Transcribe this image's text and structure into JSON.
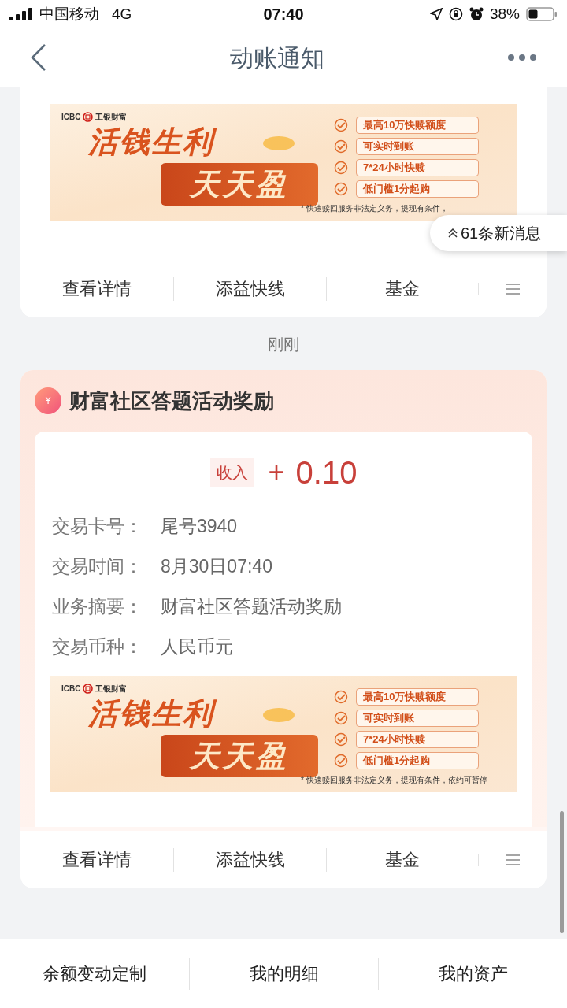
{
  "status_bar": {
    "carrier": "中国移动",
    "network": "4G",
    "time": "07:40",
    "battery": "38%"
  },
  "nav": {
    "title": "动账通知"
  },
  "new_messages": {
    "label": "61条新消息"
  },
  "cards": [
    {
      "kind": "partial",
      "banner": {
        "brand": "ICBC",
        "brand_cn": "工银财富",
        "headline": "活钱生利",
        "highlight": "天天盈",
        "features": [
          "最高10万快赎额度",
          "可实时到账",
          "7*24小时快赎",
          "低门槛1分起购"
        ],
        "footnote": "* 快速赎回服务非法定义务，提现有条件，"
      },
      "actions": [
        "查看详情",
        "添益快线",
        "基金"
      ]
    },
    {
      "kind": "full",
      "time": "刚刚",
      "title": "财富社区答题活动奖励",
      "icon_glyph": "¥",
      "badge": "收入",
      "sign": "+",
      "amount": "0.10",
      "fields": [
        {
          "label": "交易卡号：",
          "value": "尾号3940"
        },
        {
          "label": "交易时间：",
          "value": "8月30日07:40"
        },
        {
          "label": "业务摘要：",
          "value": "财富社区答题活动奖励"
        },
        {
          "label": "交易币种：",
          "value": "人民币元"
        }
      ],
      "banner": {
        "brand": "ICBC",
        "brand_cn": "工银财富",
        "headline": "活钱生利",
        "highlight": "天天盈",
        "features": [
          "最高10万快赎额度",
          "可实时到账",
          "7*24小时快赎",
          "低门槛1分起购"
        ],
        "footnote": "* 快速赎回服务非法定义务，提现有条件，依约可暂停"
      },
      "actions": [
        "查看详情",
        "添益快线",
        "基金"
      ]
    }
  ],
  "bottom_bar": [
    "余额变动定制",
    "我的明细",
    "我的资产"
  ]
}
